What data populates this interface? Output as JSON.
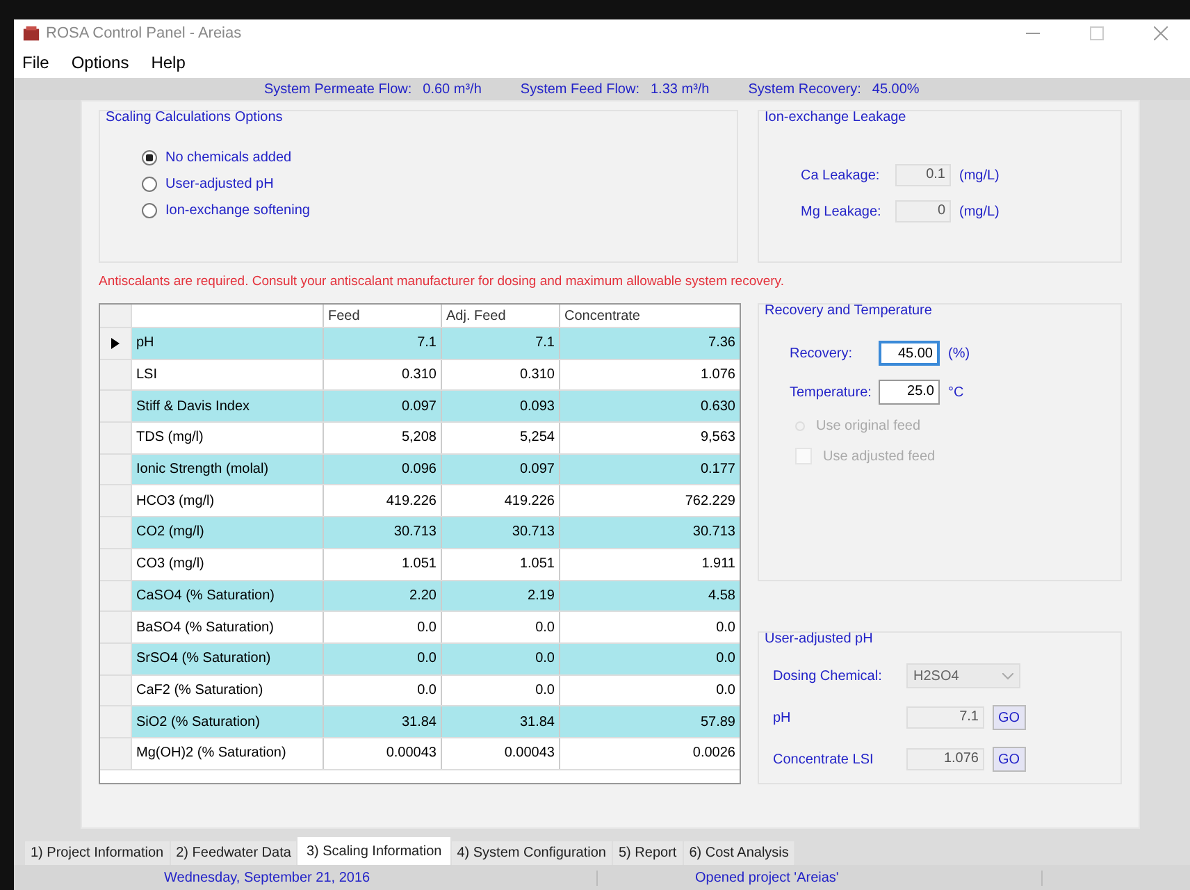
{
  "window": {
    "title": "ROSA Control Panel - Areias"
  },
  "menu": [
    "File",
    "Options",
    "Help"
  ],
  "summary": [
    {
      "label": "System Permeate Flow:",
      "value": "0.60 m³/h"
    },
    {
      "label": "System Feed Flow:",
      "value": "1.33 m³/h"
    },
    {
      "label": "System Recovery:",
      "value": "45.00%"
    }
  ],
  "scaling_options": {
    "title": "Scaling Calculations Options",
    "options": [
      {
        "label": "No chemicals added",
        "selected": true
      },
      {
        "label": "User-adjusted pH",
        "selected": false
      },
      {
        "label": "Ion-exchange softening",
        "selected": false
      }
    ]
  },
  "ion_exchange": {
    "title": "Ion-exchange Leakage",
    "fields": [
      {
        "label": "Ca Leakage:",
        "value": "0.1",
        "unit": "(mg/L)"
      },
      {
        "label": "Mg Leakage:",
        "value": "0",
        "unit": "(mg/L)"
      }
    ]
  },
  "warning": "Antiscalants are required. Consult your antiscalant manufacturer for dosing and maximum allowable system recovery.",
  "table": {
    "columns": [
      "Feed",
      "Adj. Feed",
      "Concentrate"
    ],
    "rows": [
      {
        "name": "pH",
        "values": [
          "7.1",
          "7.1",
          "7.36"
        ],
        "selected": true
      },
      {
        "name": "LSI",
        "values": [
          "0.310",
          "0.310",
          "1.076"
        ],
        "selected": false
      },
      {
        "name": "Stiff & Davis Index",
        "values": [
          "0.097",
          "0.093",
          "0.630"
        ],
        "selected": false
      },
      {
        "name": "TDS (mg/l)",
        "values": [
          "5,208",
          "5,254",
          "9,563"
        ],
        "selected": false
      },
      {
        "name": "Ionic Strength (molal)",
        "values": [
          "0.096",
          "0.097",
          "0.177"
        ],
        "selected": false
      },
      {
        "name": "HCO3 (mg/l)",
        "values": [
          "419.226",
          "419.226",
          "762.229"
        ],
        "selected": false
      },
      {
        "name": "CO2 (mg/l)",
        "values": [
          "30.713",
          "30.713",
          "30.713"
        ],
        "selected": false
      },
      {
        "name": "CO3 (mg/l)",
        "values": [
          "1.051",
          "1.051",
          "1.911"
        ],
        "selected": false
      },
      {
        "name": "CaSO4 (% Saturation)",
        "values": [
          "2.20",
          "2.19",
          "4.58"
        ],
        "selected": false
      },
      {
        "name": "BaSO4 (% Saturation)",
        "values": [
          "0.0",
          "0.0",
          "0.0"
        ],
        "selected": false
      },
      {
        "name": "SrSO4 (% Saturation)",
        "values": [
          "0.0",
          "0.0",
          "0.0"
        ],
        "selected": false
      },
      {
        "name": "CaF2 (% Saturation)",
        "values": [
          "0.0",
          "0.0",
          "0.0"
        ],
        "selected": false
      },
      {
        "name": "SiO2 (% Saturation)",
        "values": [
          "31.84",
          "31.84",
          "57.89"
        ],
        "selected": false
      },
      {
        "name": "Mg(OH)2 (% Saturation)",
        "values": [
          "0.00043",
          "0.00043",
          "0.0026"
        ],
        "selected": false
      }
    ]
  },
  "recovery": {
    "title": "Recovery and Temperature",
    "fields": [
      {
        "label": "Recovery:",
        "value": "45.00",
        "unit": "(%)"
      },
      {
        "label": "Temperature:",
        "value": "25.0",
        "unit": "°C"
      }
    ],
    "options": [
      {
        "kind": "radio",
        "label": "Use original feed",
        "checked": false,
        "disabled": true
      },
      {
        "kind": "checkbox",
        "label": "Use adjusted feed",
        "checked": false,
        "disabled": true
      }
    ]
  },
  "user_ph": {
    "title": "User-adjusted pH",
    "dosing_label": "Dosing Chemical:",
    "dosing_value": "H2SO4",
    "rows": [
      {
        "label": "pH",
        "value": "7.1",
        "button": "GO"
      },
      {
        "label": "Concentrate LSI",
        "value": "1.076",
        "button": "GO"
      }
    ]
  },
  "tabs": [
    {
      "label": "1) Project Information",
      "selected": false
    },
    {
      "label": "2) Feedwater Data",
      "selected": false
    },
    {
      "label": "3) Scaling Information",
      "selected": true
    },
    {
      "label": "4) System Configuration",
      "selected": false
    },
    {
      "label": "5) Report",
      "selected": false
    },
    {
      "label": "6) Cost Analysis",
      "selected": false
    }
  ],
  "status_bar": [
    "Wednesday, September 21, 2016",
    "Opened project 'Areias'"
  ]
}
